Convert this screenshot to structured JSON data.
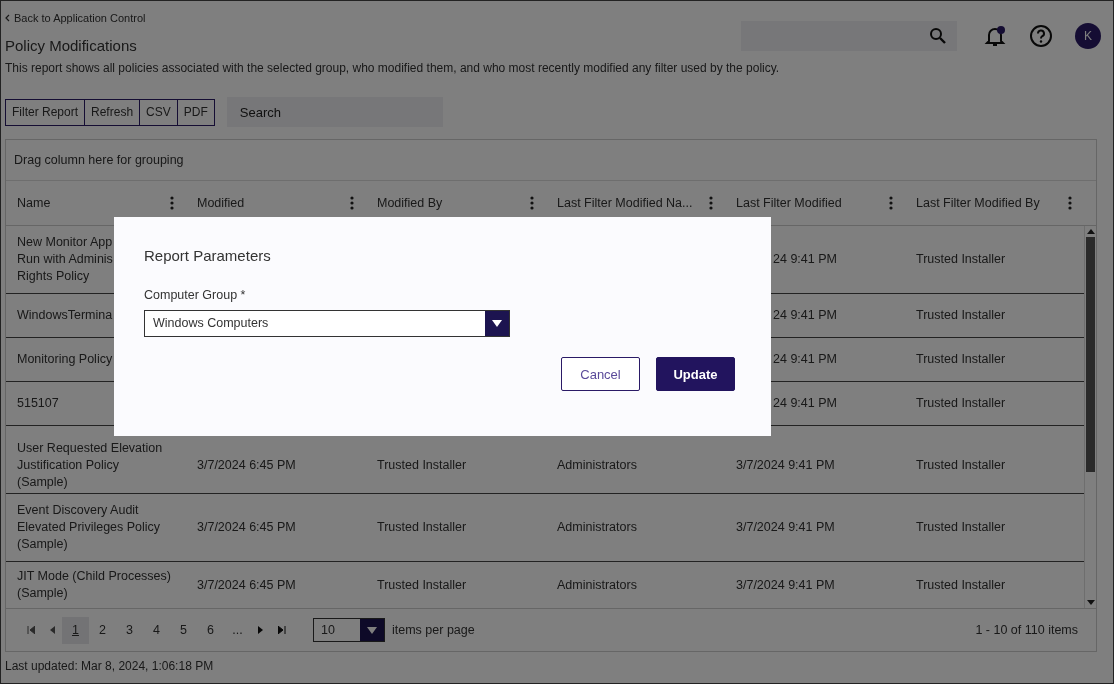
{
  "back_link": "Back to Application Control",
  "title": "Policy Modifications",
  "description": "This report shows all policies associated with the selected group, who modified them, and who most recently modified any filter used by the policy.",
  "user_initial": "K",
  "notifications_unread": true,
  "toolbar": [
    "Filter Report",
    "Refresh",
    "CSV",
    "PDF"
  ],
  "search": {
    "placeholder": "Search"
  },
  "grouping_hint": "Drag column here for grouping",
  "columns": [
    "Name",
    "Modified",
    "Modified By",
    "Last Filter Modified Na...",
    "Last Filter Modified",
    "Last Filter Modified By"
  ],
  "rows": [
    {
      "covered": true,
      "cells": [
        "New Monitor App\nRun with Adminis\nRights Policy",
        "",
        "",
        "",
        "24 9:41 PM",
        "Trusted Installer"
      ]
    },
    {
      "covered": true,
      "cells": [
        "WindowsTermina",
        "",
        "",
        "",
        "24 9:41 PM",
        "Trusted Installer"
      ]
    },
    {
      "covered": true,
      "cells": [
        "Monitoring Policy",
        "",
        "",
        "",
        "24 9:41 PM",
        "Trusted Installer"
      ]
    },
    {
      "covered": true,
      "cells": [
        "515107",
        "",
        "",
        "",
        "24 9:41 PM",
        "Trusted Installer"
      ]
    },
    {
      "covered": false,
      "cells": [
        "User Requested Elevation\nJustification Policy\n(Sample)",
        "3/7/2024 6:45 PM",
        "Trusted Installer",
        "Administrators",
        "3/7/2024 9:41 PM",
        "Trusted Installer"
      ]
    },
    {
      "covered": false,
      "cells": [
        "Event Discovery Audit\nElevated Privileges Policy\n(Sample)",
        "3/7/2024 6:45 PM",
        "Trusted Installer",
        "Administrators",
        "3/7/2024 9:41 PM",
        "Trusted Installer"
      ]
    },
    {
      "covered": false,
      "cells": [
        "JIT Mode (Child Processes)\n(Sample)",
        "3/7/2024 6:45 PM",
        "Trusted Installer",
        "Administrators",
        "3/7/2024 9:41 PM",
        "Trusted Installer"
      ]
    }
  ],
  "pager": {
    "pages": [
      {
        "label": "1",
        "selected": true
      },
      {
        "label": "2",
        "selected": false
      },
      {
        "label": "3",
        "selected": false
      },
      {
        "label": "4",
        "selected": false
      },
      {
        "label": "5",
        "selected": false
      },
      {
        "label": "6",
        "selected": false
      },
      {
        "label": "...",
        "selected": false
      }
    ],
    "page_size": "10",
    "page_size_label": "items per page",
    "summary": "1 - 10 of 110 items"
  },
  "last_updated": "Last updated: Mar 8, 2024, 1:06:18 PM",
  "modal": {
    "title": "Report Parameters",
    "field_label": "Computer Group *",
    "field_value": "Windows Computers",
    "buttons": [
      {
        "label": "Cancel",
        "kind": "secondary"
      },
      {
        "label": "Update",
        "kind": "primary"
      }
    ]
  }
}
